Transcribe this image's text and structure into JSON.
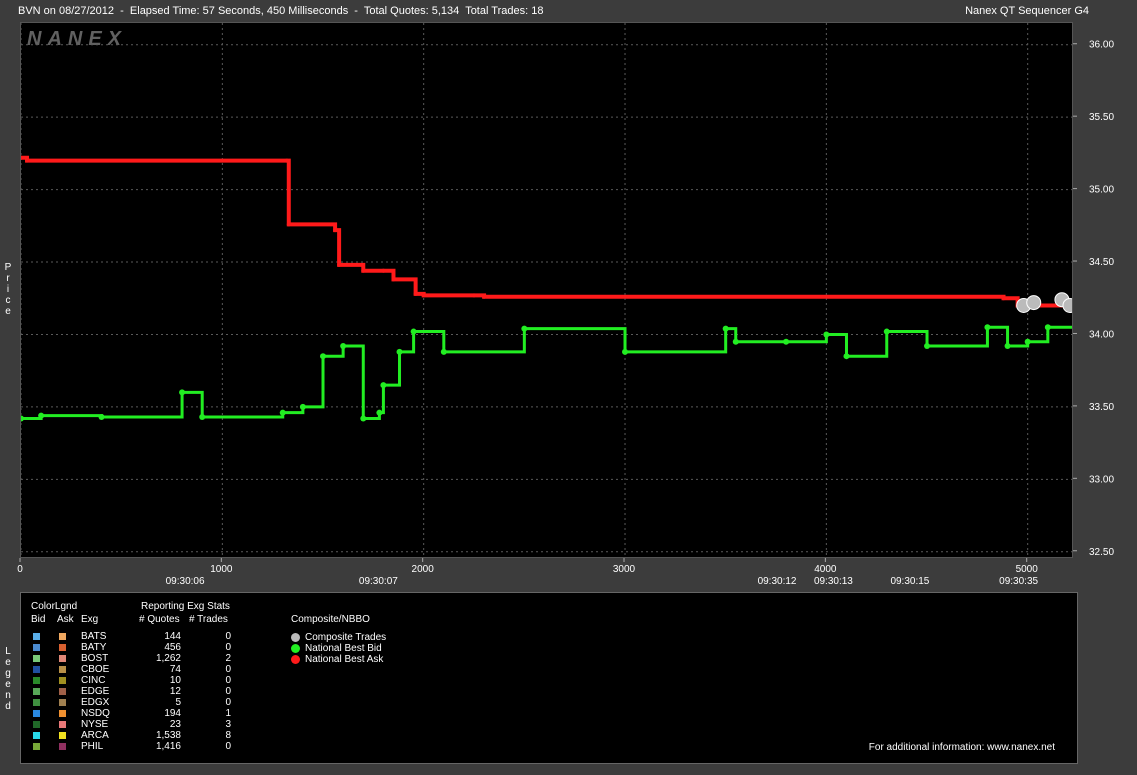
{
  "window": {
    "title_left": "BVN on 08/27/2012  -  Elapsed Time: 57 Seconds, 450 Milliseconds  -  Total Quotes: 5,134  Total Trades: 18",
    "title_right": "Nanex QT Sequencer G4"
  },
  "watermark": "NANEX",
  "side_labels": {
    "price": "Price",
    "legend": "Legend"
  },
  "chart_data": {
    "type": "line",
    "title": "BVN on 08/27/2012",
    "ylabel": "Price",
    "ylim": [
      32.45,
      36.15
    ],
    "xlim": [
      0,
      5230
    ],
    "yticks": [
      "36.00",
      "35.50",
      "35.00",
      "34.50",
      "34.00",
      "33.50",
      "33.00",
      "32.50"
    ],
    "xticks": [
      "0",
      "1000",
      "2000",
      "3000",
      "4000",
      "5000"
    ],
    "time_labels": [
      {
        "x": 820,
        "label": "09:30:06"
      },
      {
        "x": 1780,
        "label": "09:30:07"
      },
      {
        "x": 3760,
        "label": "09:30:12"
      },
      {
        "x": 4040,
        "label": "09:30:13"
      },
      {
        "x": 4420,
        "label": "09:30:15"
      },
      {
        "x": 4960,
        "label": "09:30:35"
      }
    ],
    "grid": true,
    "series": [
      {
        "name": "National Best Ask",
        "color": "#ff1a1a",
        "x": [
          0,
          30,
          1320,
          1330,
          1560,
          1580,
          1700,
          1800,
          1850,
          1960,
          2000,
          2250,
          2300,
          4880,
          4950,
          5100,
          5230
        ],
        "y": [
          35.22,
          35.2,
          35.2,
          34.76,
          34.72,
          34.48,
          34.44,
          34.44,
          34.38,
          34.28,
          34.27,
          34.27,
          34.26,
          34.25,
          34.2,
          34.2,
          34.22
        ]
      },
      {
        "name": "National Best Bid",
        "color": "#22ee22",
        "x": [
          0,
          100,
          400,
          800,
          900,
          1300,
          1400,
          1500,
          1600,
          1700,
          1780,
          1800,
          1880,
          1950,
          2100,
          2500,
          3000,
          3500,
          3550,
          3800,
          4000,
          4100,
          4300,
          4500,
          4800,
          4900,
          5000,
          5100,
          5230
        ],
        "y": [
          33.42,
          33.44,
          33.43,
          33.6,
          33.43,
          33.46,
          33.5,
          33.85,
          33.92,
          33.42,
          33.46,
          33.65,
          33.88,
          34.02,
          33.88,
          34.04,
          33.88,
          34.04,
          33.95,
          33.95,
          34.0,
          33.85,
          34.02,
          33.92,
          34.05,
          33.92,
          33.95,
          34.05,
          34.18
        ]
      },
      {
        "name": "Composite Trades",
        "color": "#bbbbbb",
        "x": [
          4980,
          5030,
          5170,
          5210
        ],
        "y": [
          34.2,
          34.22,
          34.24,
          34.2
        ]
      }
    ]
  },
  "legend": {
    "headers": {
      "color_legend": "ColorLgnd",
      "bid": "Bid",
      "ask": "Ask",
      "exg": "Exg",
      "reporting": "Reporting Exg Stats",
      "quotes": "# Quotes",
      "trades": "# Trades",
      "composite": "Composite/NBBO"
    },
    "exchanges": [
      {
        "name": "BATS",
        "quotes": "144",
        "trades": "0",
        "bid_color": "#5aaee8",
        "ask_color": "#f0a860"
      },
      {
        "name": "BATY",
        "quotes": "456",
        "trades": "0",
        "bid_color": "#4a8ad0",
        "ask_color": "#d86030"
      },
      {
        "name": "BOST",
        "quotes": "1,262",
        "trades": "2",
        "bid_color": "#78c878",
        "ask_color": "#e08878"
      },
      {
        "name": "CBOE",
        "quotes": "74",
        "trades": "0",
        "bid_color": "#2050a0",
        "ask_color": "#b89048"
      },
      {
        "name": "CINC",
        "quotes": "10",
        "trades": "0",
        "bid_color": "#2a8a2a",
        "ask_color": "#a09020"
      },
      {
        "name": "EDGE",
        "quotes": "12",
        "trades": "0",
        "bid_color": "#58a858",
        "ask_color": "#a06048"
      },
      {
        "name": "EDGX",
        "quotes": "5",
        "trades": "0",
        "bid_color": "#409040",
        "ask_color": "#a08050"
      },
      {
        "name": "NSDQ",
        "quotes": "194",
        "trades": "1",
        "bid_color": "#2a88e0",
        "ask_color": "#f09030"
      },
      {
        "name": "NYSE",
        "quotes": "23",
        "trades": "3",
        "bid_color": "#206828",
        "ask_color": "#e87878"
      },
      {
        "name": "ARCA",
        "quotes": "1,538",
        "trades": "8",
        "bid_color": "#28d8e8",
        "ask_color": "#f0e020"
      },
      {
        "name": "PHIL",
        "quotes": "1,416",
        "trades": "0",
        "bid_color": "#78a838",
        "ask_color": "#903060"
      }
    ],
    "composite": [
      {
        "label": "Composite Trades",
        "color": "#bbbbbb"
      },
      {
        "label": "National Best Bid",
        "color": "#22ee22"
      },
      {
        "label": "National Best Ask",
        "color": "#ff1a1a"
      }
    ],
    "footer": "For additional information: www.nanex.net"
  }
}
